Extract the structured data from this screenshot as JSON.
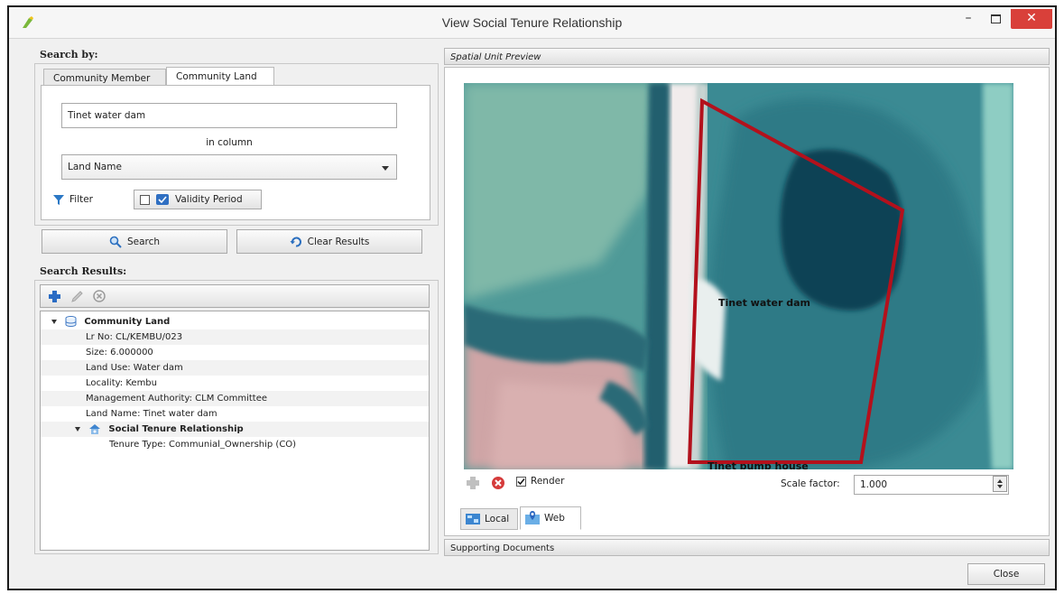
{
  "window": {
    "title": "View Social Tenure Relationship"
  },
  "search": {
    "group_title": "Search by:",
    "tabs": [
      "Community Member",
      "Community Land"
    ],
    "active_tab": 1,
    "query_value": "Tinet water dam",
    "in_column_label": "in column",
    "column_selected": "Land Name",
    "filter_label": "Filter",
    "validity_label": "Validity Period",
    "search_button": "Search",
    "clear_button": "Clear Results"
  },
  "results": {
    "title": "Search Results:",
    "tree": {
      "root": "Community Land",
      "fields": [
        "Lr No: CL/KEMBU/023",
        "Size: 6.000000",
        "Land Use: Water dam",
        "Locality: Kembu",
        "Management Authority: CLM Committee",
        "Land Name: Tinet water dam"
      ],
      "child": "Social Tenure Relationship",
      "child_fields": [
        "Tenure Type: Communial_Ownership (CO)"
      ]
    }
  },
  "preview": {
    "header": "Spatial Unit Preview",
    "map_label": "Tinet water dam",
    "map_label_bottom": "Tinet pump house",
    "render_label": "Render",
    "render_checked": true,
    "scale_label": "Scale factor:",
    "scale_value": "1.000",
    "tabs": [
      "Local",
      "Web"
    ],
    "active_tab": 1,
    "polygon_color": "#b3111c"
  },
  "documents": {
    "header": "Supporting Documents"
  },
  "footer": {
    "close_button": "Close"
  }
}
